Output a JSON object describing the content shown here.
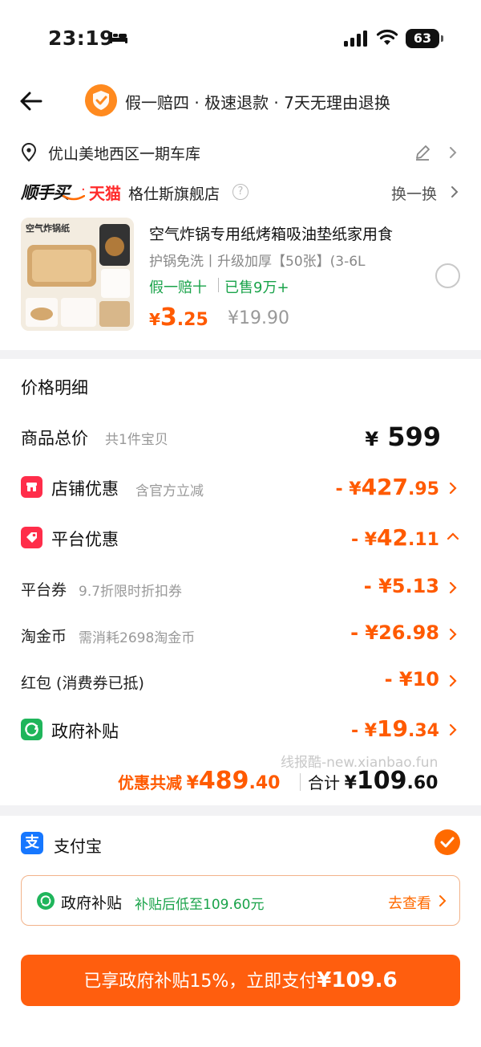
{
  "status_bar": {
    "time": "23:19",
    "battery": "63"
  },
  "header": {
    "guarantee_text": "假一赔四 · 极速退款 · 7天无理由退换"
  },
  "address": {
    "text": "优山美地西区一期车库"
  },
  "store": {
    "brand_prefix": "顺手买",
    "dot": "·",
    "brand_tmall": "天猫",
    "name": "格仕斯旗舰店",
    "help": "?",
    "change_label": "换一换"
  },
  "product": {
    "title": "空气炸锅专用纸烤箱吸油垫纸家用食",
    "spec": "护锅免洗丨升级加厚【50张】(3-6L",
    "tag": "假一赔十",
    "sold": "已售9万+",
    "price_currency": "¥",
    "price_int": "3",
    "price_dec": ".25",
    "original_price": "¥19.90",
    "image_title": "空气炸锅纸"
  },
  "price_detail": {
    "title": "价格明细",
    "total_label": "商品总价",
    "total_sub": "共1件宝贝",
    "total_currency": "¥",
    "total_value": "599",
    "store_discount": {
      "label": "店铺优惠",
      "sub": "含官方立减",
      "prefix": "- ¥",
      "int": "427",
      "dec": ".95"
    },
    "platform_discount": {
      "label": "平台优惠",
      "prefix": "- ¥",
      "int": "42",
      "dec": ".11"
    },
    "coupon": {
      "label": "平台券",
      "sub": "9.7折限时折扣券",
      "value": "- ¥5.13"
    },
    "coins": {
      "label": "淘金币",
      "sub": "需消耗2698淘金币",
      "value": "- ¥26.98"
    },
    "redpacket": {
      "label": "红包 (消费券已抵)",
      "value": "- ¥10"
    },
    "gov_subsidy": {
      "label": "政府补贴",
      "prefix": "- ¥",
      "int": "19",
      "dec": ".34"
    },
    "watermark": "线报酷-new.xianbao.fun",
    "discount_total": {
      "label": "优惠共减",
      "currency": "¥",
      "int": "489",
      "dec": ".40"
    },
    "grand_total": {
      "label": "合计",
      "currency": "¥",
      "int": "109",
      "dec": ".60"
    }
  },
  "payment": {
    "method": "支付宝",
    "method_icon": "支",
    "subsidy_label": "政府补贴",
    "subsidy_note": "补贴后低至109.60元",
    "subsidy_link": "去查看",
    "button_text": "已享政府补贴15%，立即支付",
    "button_amount": "¥109.6"
  },
  "colors": {
    "accent": "#ff5a00",
    "green": "#1aa34a",
    "button": "#ff5e0e"
  }
}
